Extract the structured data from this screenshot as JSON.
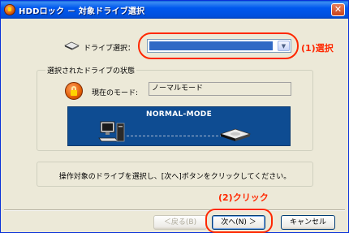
{
  "window": {
    "title": "HDDロック － 対象ドライブ選択",
    "close_label": "✕"
  },
  "drive": {
    "label": "ドライブ選択：",
    "selected_value": ""
  },
  "annotations": {
    "step1": "(1)選択",
    "step2": "(2)クリック"
  },
  "status_group": {
    "title": "選択されたドライブの状態",
    "mode_label": "現在のモード:",
    "mode_value": "ノーマルモード",
    "panel_title": "NORMAL-MODE"
  },
  "info": {
    "text": "操作対象のドライブを選択し、[次へ]ボタンをクリックしてください。"
  },
  "buttons": {
    "back": "＜戻る(B)",
    "next": "次へ(N) ＞",
    "cancel": "キャンセル"
  },
  "icons": {
    "app": "hdd-lock-icon",
    "drive": "drive-icon",
    "lock": "lock-icon",
    "pc": "pc-icon",
    "hdd": "hdd-icon",
    "close": "close-icon",
    "dropdown": "chevron-down-icon"
  },
  "colors": {
    "titlebar": "#0058ee",
    "annotation": "#ff2800",
    "panel": "#0e4c92",
    "selection": "#316ac5"
  }
}
